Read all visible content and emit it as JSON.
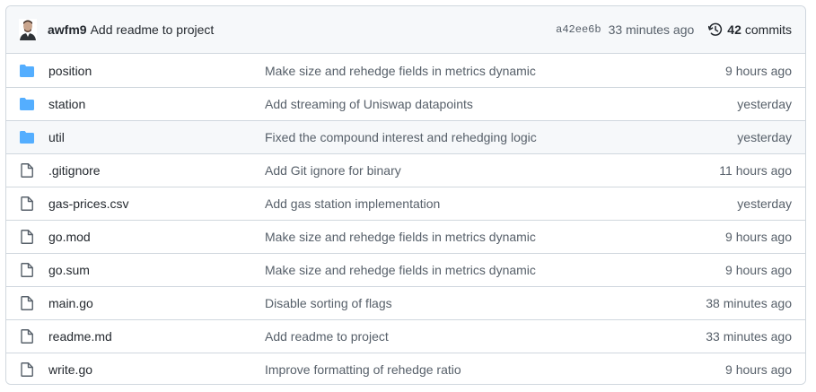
{
  "latest_commit": {
    "author": "awfm9",
    "message": "Add readme to project",
    "sha": "a42ee6b",
    "time_ago": "33 minutes ago",
    "commits_count": "42",
    "commits_label": "commits"
  },
  "colors": {
    "folder": "#54aeff",
    "file_icon": "#57606a",
    "border": "#d0d7de",
    "header_bg": "#f6f8fa"
  },
  "files": [
    {
      "type": "folder",
      "name": "position",
      "commit": "Make size and rehedge fields in metrics dynamic",
      "age": "9 hours ago"
    },
    {
      "type": "folder",
      "name": "station",
      "commit": "Add streaming of Uniswap datapoints",
      "age": "yesterday"
    },
    {
      "type": "folder",
      "name": "util",
      "commit": "Fixed the compound interest and rehedging logic",
      "age": "yesterday"
    },
    {
      "type": "file",
      "name": ".gitignore",
      "commit": "Add Git ignore for binary",
      "age": "11 hours ago"
    },
    {
      "type": "file",
      "name": "gas-prices.csv",
      "commit": "Add gas station implementation",
      "age": "yesterday"
    },
    {
      "type": "file",
      "name": "go.mod",
      "commit": "Make size and rehedge fields in metrics dynamic",
      "age": "9 hours ago"
    },
    {
      "type": "file",
      "name": "go.sum",
      "commit": "Make size and rehedge fields in metrics dynamic",
      "age": "9 hours ago"
    },
    {
      "type": "file",
      "name": "main.go",
      "commit": "Disable sorting of flags",
      "age": "38 minutes ago"
    },
    {
      "type": "file",
      "name": "readme.md",
      "commit": "Add readme to project",
      "age": "33 minutes ago"
    },
    {
      "type": "file",
      "name": "write.go",
      "commit": "Improve formatting of rehedge ratio",
      "age": "9 hours ago"
    }
  ]
}
